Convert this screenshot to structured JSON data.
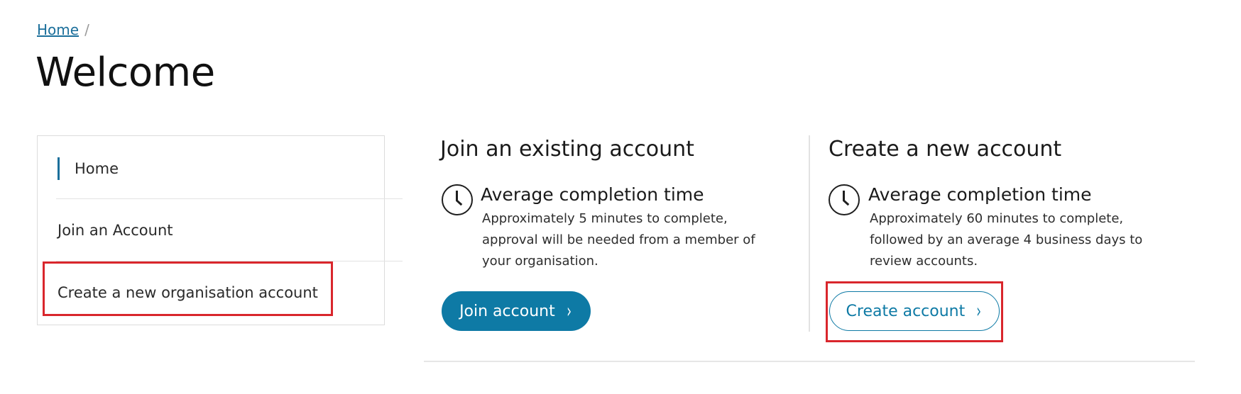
{
  "breadcrumb": {
    "home": "Home",
    "separator": "/"
  },
  "page": {
    "title": "Welcome"
  },
  "sidebar": {
    "items": [
      {
        "label": "Home"
      },
      {
        "label": "Join an Account"
      },
      {
        "label": "Create a new organisation account"
      }
    ]
  },
  "join_section": {
    "title": "Join an existing account",
    "info_heading": "Average completion time",
    "info_body": "Approximately 5 minutes to complete, approval will be needed from a member of your organisation.",
    "button_label": "Join account",
    "button_chevron": "›"
  },
  "create_section": {
    "title": "Create a new account",
    "info_heading": "Average completion time",
    "info_body": "Approximately 60 minutes to complete, followed by an average 4 business days to review accounts.",
    "button_label": "Create account",
    "button_chevron": "›"
  },
  "colors": {
    "accent": "#0e7aa5",
    "link": "#1b6f9b",
    "highlight": "#d9262c"
  }
}
